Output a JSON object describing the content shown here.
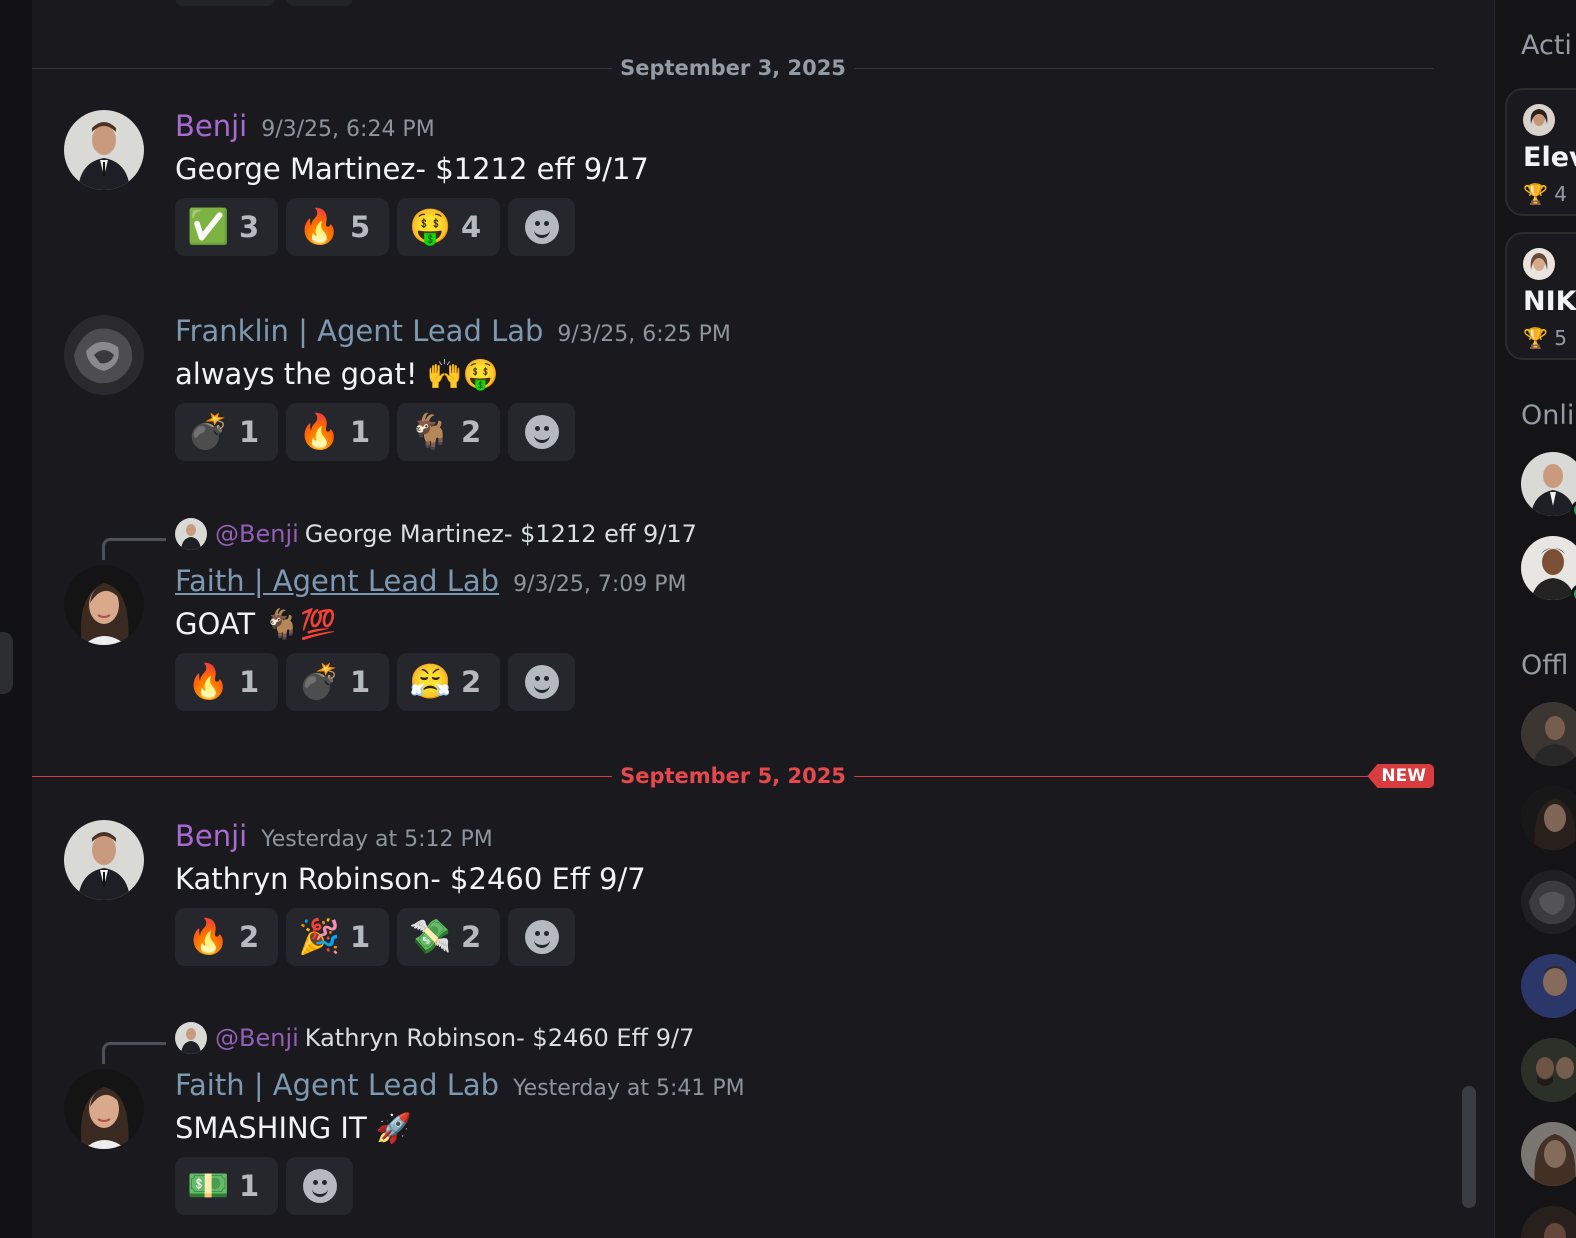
{
  "colors": {
    "benji": "#a76ad1",
    "lab": "#7c99b1",
    "new_red": "#d83c3e",
    "online": "#23a55a"
  },
  "dividers": {
    "sep3": "September 3, 2025",
    "sep5": "September 5, 2025",
    "new_badge": "NEW"
  },
  "messages": [
    {
      "username": "Benji",
      "timestamp": "9/3/25, 6:24 PM",
      "content": "George Martinez- $1212 eff 9/17",
      "reactions": [
        {
          "emoji": "✅",
          "count": "3"
        },
        {
          "emoji": "🔥",
          "count": "5"
        },
        {
          "emoji": "🤑",
          "count": "4"
        }
      ]
    },
    {
      "username": "Franklin | Agent Lead Lab",
      "timestamp": "9/3/25, 6:25 PM",
      "content": "always the goat! 🙌🤑",
      "reactions": [
        {
          "emoji": "💣",
          "count": "1"
        },
        {
          "emoji": "🔥",
          "count": "1"
        },
        {
          "emoji": "🐐",
          "count": "2"
        }
      ]
    },
    {
      "reply": {
        "mention": "@Benji",
        "text": "George Martinez- $1212 eff 9/17"
      },
      "username": "Faith | Agent Lead Lab",
      "timestamp": "9/3/25, 7:09 PM",
      "content": "GOAT 🐐💯",
      "reactions": [
        {
          "emoji": "🔥",
          "count": "1"
        },
        {
          "emoji": "💣",
          "count": "1"
        },
        {
          "emoji": "😤",
          "count": "2"
        }
      ]
    },
    {
      "username": "Benji",
      "timestamp": "Yesterday at 5:12 PM",
      "content": "Kathryn Robinson- $2460 Eff 9/7",
      "reactions": [
        {
          "emoji": "🔥",
          "count": "2"
        },
        {
          "emoji": "🎉",
          "count": "1"
        },
        {
          "emoji": "💸",
          "count": "2"
        }
      ]
    },
    {
      "reply": {
        "mention": "@Benji",
        "text": "Kathryn Robinson- $2460 Eff 9/7"
      },
      "username": "Faith | Agent Lead Lab",
      "timestamp": "Yesterday at 5:41 PM",
      "content": "SMASHING IT 🚀",
      "reactions": [
        {
          "emoji": "💵",
          "count": "1"
        }
      ]
    }
  ],
  "sidebar": {
    "active_title": "Acti",
    "online_title": "Onli",
    "offline_title": "Offl",
    "cards": [
      {
        "name": "Elev",
        "trophy": "🏆 4"
      },
      {
        "name": "NIK",
        "trophy": "🏆 5"
      }
    ]
  }
}
